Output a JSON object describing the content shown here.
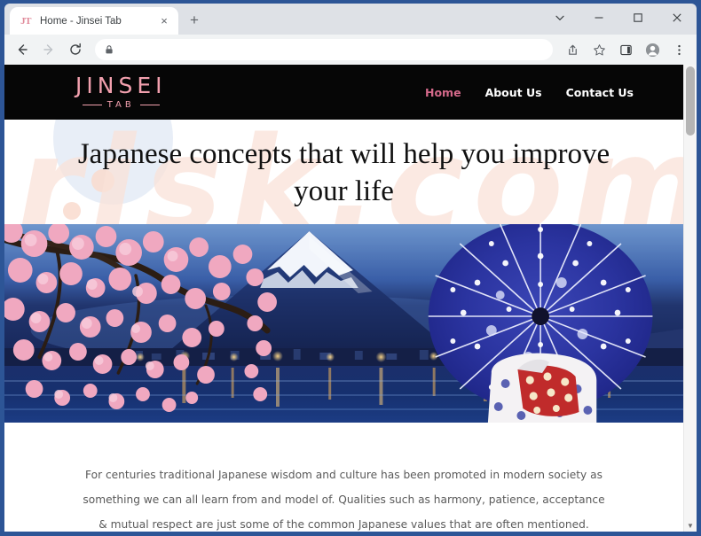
{
  "browser": {
    "tab": {
      "favicon_text": "JT",
      "title": "Home - Jinsei Tab",
      "close_icon": "×"
    },
    "new_tab_label": "+",
    "window_controls": [
      {
        "name": "tab-search-chevron-down-icon",
        "glyph": "⌄"
      },
      {
        "name": "minimize-icon",
        "glyph": "–"
      },
      {
        "name": "maximize-icon",
        "glyph": "□"
      },
      {
        "name": "close-icon",
        "glyph": "✕"
      }
    ],
    "toolbar": {
      "back_icon": "←",
      "forward_icon": "→",
      "reload_icon": "⟳",
      "address_value": "",
      "address_placeholder": "",
      "lock_icon": "lock-icon",
      "share_icon": "share-icon",
      "bookmark_icon": "star-icon",
      "sidepanel_icon": "side-panel-icon",
      "profile_icon": "profile-avatar-icon",
      "menu_icon": "⋮"
    }
  },
  "site": {
    "logo": {
      "main": "JINSEI",
      "sub": "TAB"
    },
    "nav": [
      {
        "label": "Home",
        "active": true
      },
      {
        "label": "About Us",
        "active": false
      },
      {
        "label": "Contact Us",
        "active": false
      }
    ],
    "hero": {
      "heading": "Japanese concepts that will help you improve your life",
      "image_alt": "Cherry blossoms, Mount Fuji over a lake at dusk, and a woman in kimono holding a blue wagasa umbrella"
    },
    "body": {
      "paragraph": "For centuries traditional Japanese wisdom and culture has been promoted in modern society as something we can all learn from and model of. Qualities such as harmony, patience, acceptance & mutual respect are just some of the common Japanese values that are often mentioned."
    },
    "watermark": "risk.com"
  },
  "colors": {
    "window_border": "#2d5596",
    "header_bg": "#060606",
    "brand_pink": "#f2a0ae",
    "nav_active": "#d4698a",
    "heading": "#111111",
    "body_text": "#5a5a5a"
  }
}
